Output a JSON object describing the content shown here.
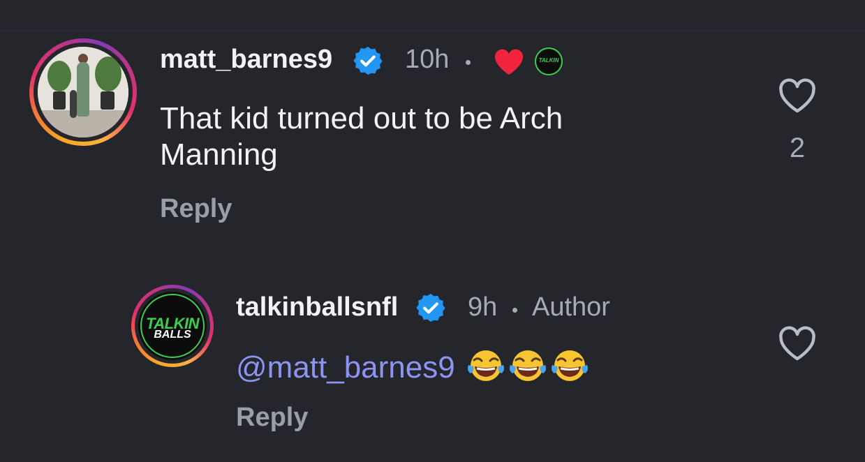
{
  "comment_1": {
    "username": "matt_barnes9",
    "time": "10h",
    "text": "That kid turned out to be Arch Manning",
    "reply_label": "Reply",
    "like_count": "2"
  },
  "comment_2": {
    "username": "talkinballsnfl",
    "time": "9h",
    "author_badge": "Author",
    "mention": "@matt_barnes9",
    "reply_label": "Reply"
  },
  "logo": {
    "line1": "TALKIN",
    "line2": "BALLS"
  },
  "colors": {
    "background": "#24262c",
    "verified": "#2196f3",
    "heart_red": "#f0243c",
    "mention": "#8d93f0",
    "logo_green": "#3ccf4e"
  },
  "icons": [
    "verified-badge-icon",
    "red-heart-icon",
    "heart-outline-icon",
    "laughing-emoji-icon"
  ]
}
